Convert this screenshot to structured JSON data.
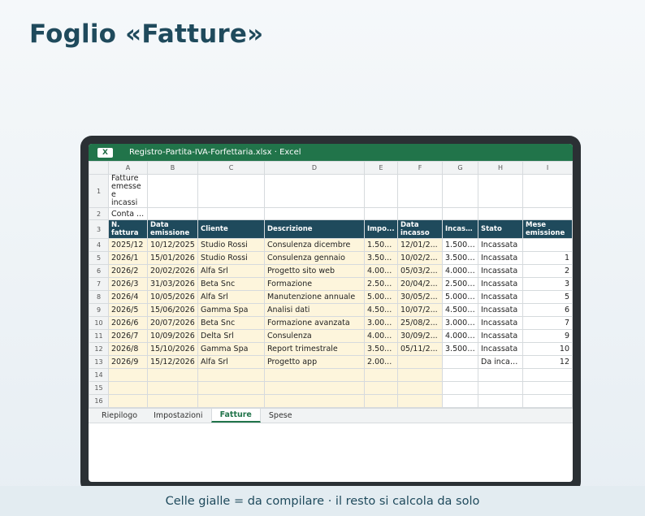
{
  "page": {
    "title": "Foglio «Fatture»",
    "caption": "Celle gialle = da compilare · il resto si calcola da solo"
  },
  "window": {
    "app_icon_label": "X",
    "title": "Registro-Partita-IVA-Forfettaria.xlsx · Excel"
  },
  "sheet": {
    "columns": [
      "A",
      "B",
      "C",
      "D",
      "E",
      "F",
      "G",
      "H",
      "I"
    ],
    "row_numbers": [
      "1",
      "2",
      "3",
      "4",
      "5",
      "6",
      "7",
      "8",
      "9",
      "10",
      "11",
      "12",
      "13",
      "14",
      "15",
      "16"
    ],
    "section_title": "Fatture emesse e incassi",
    "note": "Conta ...",
    "headers": [
      "N. fattura",
      "Data emissione",
      "Cliente",
      "Descrizione",
      "Impo...",
      "Data incasso",
      "Incass...",
      "Stato",
      "Mese emissione"
    ],
    "rows": [
      [
        "2025/12",
        "10/12/2025",
        "Studio Rossi",
        "Consulenza dicembre",
        "1.50...",
        "12/01/2...",
        "1.500....",
        "Incassata",
        ""
      ],
      [
        "2026/1",
        "15/01/2026",
        "Studio Rossi",
        "Consulenza gennaio",
        "3.50...",
        "10/02/2...",
        "3.500....",
        "Incassata",
        "1"
      ],
      [
        "2026/2",
        "20/02/2026",
        "Alfa Srl",
        "Progetto sito web",
        "4.00...",
        "05/03/2...",
        "4.000....",
        "Incassata",
        "2"
      ],
      [
        "2026/3",
        "31/03/2026",
        "Beta Snc",
        "Formazione",
        "2.50...",
        "20/04/2...",
        "2.500....",
        "Incassata",
        "3"
      ],
      [
        "2026/4",
        "10/05/2026",
        "Alfa Srl",
        "Manutenzione annuale",
        "5.00...",
        "30/05/2...",
        "5.000....",
        "Incassata",
        "5"
      ],
      [
        "2026/5",
        "15/06/2026",
        "Gamma Spa",
        "Analisi dati",
        "4.50...",
        "10/07/2...",
        "4.500....",
        "Incassata",
        "6"
      ],
      [
        "2026/6",
        "20/07/2026",
        "Beta Snc",
        "Formazione avanzata",
        "3.00...",
        "25/08/2...",
        "3.000....",
        "Incassata",
        "7"
      ],
      [
        "2026/7",
        "10/09/2026",
        "Delta Srl",
        "Consulenza",
        "4.00...",
        "30/09/2...",
        "4.000....",
        "Incassata",
        "9"
      ],
      [
        "2026/8",
        "15/10/2026",
        "Gamma Spa",
        "Report trimestrale",
        "3.50...",
        "05/11/2...",
        "3.500....",
        "Incassata",
        "10"
      ],
      [
        "2026/9",
        "15/12/2026",
        "Alfa Srl",
        "Progetto app",
        "2.00...",
        "",
        "",
        "Da incas...",
        "12"
      ]
    ],
    "tabs": [
      {
        "label": "Riepilogo",
        "active": false
      },
      {
        "label": "Impostazioni",
        "active": false
      },
      {
        "label": "Fatture",
        "active": true
      },
      {
        "label": "Spese",
        "active": false
      }
    ]
  },
  "colors": {
    "header_fill": "#1f4a5c",
    "input_fill": "#fdf5dc",
    "excel_green": "#21744a"
  }
}
